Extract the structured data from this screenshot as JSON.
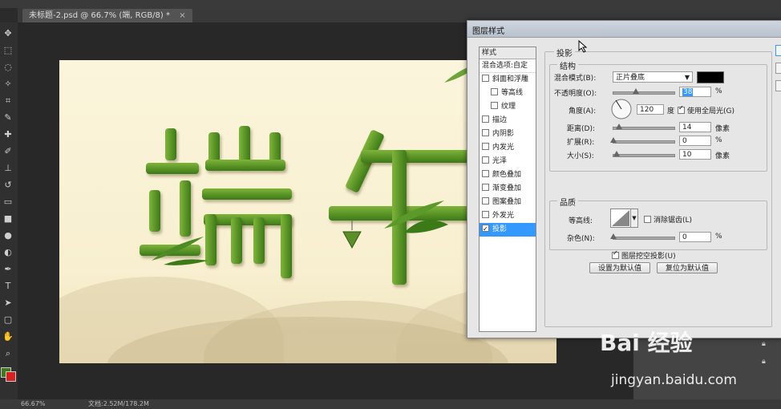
{
  "app": {
    "title_bar_fragment": "",
    "document_tab": "未标题-2.psd @ 66.7% (端, RGB/8) *",
    "tab_close": "×"
  },
  "status_bar": {
    "zoom": "66.67%",
    "doc_size": "文档:2.52M/178.2M"
  },
  "tools": [
    "move-icon",
    "marquee-icon",
    "lasso-icon",
    "magic-wand-icon",
    "crop-icon",
    "eyedropper-icon",
    "healing-icon",
    "brush-icon",
    "stamp-icon",
    "history-brush-icon",
    "eraser-icon",
    "gradient-icon",
    "blur-icon",
    "dodge-icon",
    "pen-icon",
    "type-icon",
    "path-select-icon",
    "shape-icon",
    "hand-icon",
    "zoom-icon"
  ],
  "tool_glyphs": [
    "✥",
    "⬚",
    "◌",
    "✧",
    "⌗",
    "✎",
    "✚",
    "✐",
    "⊥",
    "↺",
    "▭",
    "■",
    "●",
    "◐",
    "✒",
    "T",
    "➤",
    "▢",
    "✋",
    "⌕"
  ],
  "canvas": {
    "artwork_text": [
      "端",
      "午"
    ],
    "colors": {
      "bamboo_light": "#7fb43a",
      "bamboo_dark": "#3c7a18",
      "background": "#fbf5dc"
    }
  },
  "dialog": {
    "title": "图层样式",
    "styles_header": "样式",
    "blend_default": "混合选项:自定",
    "style_items": [
      {
        "label": "斜面和浮雕",
        "checked": false,
        "indent": false
      },
      {
        "label": "等高线",
        "checked": false,
        "indent": true
      },
      {
        "label": "纹理",
        "checked": false,
        "indent": true
      },
      {
        "label": "描边",
        "checked": false,
        "indent": false
      },
      {
        "label": "内阴影",
        "checked": false,
        "indent": false
      },
      {
        "label": "内发光",
        "checked": false,
        "indent": false
      },
      {
        "label": "光泽",
        "checked": false,
        "indent": false
      },
      {
        "label": "颜色叠加",
        "checked": false,
        "indent": false
      },
      {
        "label": "渐变叠加",
        "checked": false,
        "indent": false
      },
      {
        "label": "图案叠加",
        "checked": false,
        "indent": false
      },
      {
        "label": "外发光",
        "checked": false,
        "indent": false
      },
      {
        "label": "投影",
        "checked": true,
        "indent": false,
        "selected": true
      }
    ],
    "section_title": "投影",
    "structure": {
      "title": "结构",
      "blend_mode_label": "混合模式(B):",
      "blend_mode_value": "正片叠底",
      "shadow_color": "#000000",
      "opacity_label": "不透明度(O):",
      "opacity_value": "38",
      "opacity_unit": "%",
      "angle_label": "角度(A):",
      "angle_value": "120",
      "angle_unit": "度",
      "global_light_label": "使用全局光(G)",
      "global_light_checked": true,
      "distance_label": "距离(D):",
      "distance_value": "14",
      "distance_unit": "像素",
      "spread_label": "扩展(R):",
      "spread_value": "0",
      "spread_unit": "%",
      "size_label": "大小(S):",
      "size_value": "10",
      "size_unit": "像素"
    },
    "quality": {
      "title": "品质",
      "contour_label": "等高线:",
      "antialias_label": "消除锯齿(L)",
      "noise_label": "杂色(N):",
      "noise_value": "0",
      "noise_unit": "%"
    },
    "knockout_label": "图层挖空投影(U)",
    "knockout_checked": true,
    "set_default_button": "设置为默认值",
    "reset_default_button": "复位为默认值"
  },
  "watermark": {
    "logo_text": "Bai 经验",
    "url": "jingyan.baidu.com"
  }
}
